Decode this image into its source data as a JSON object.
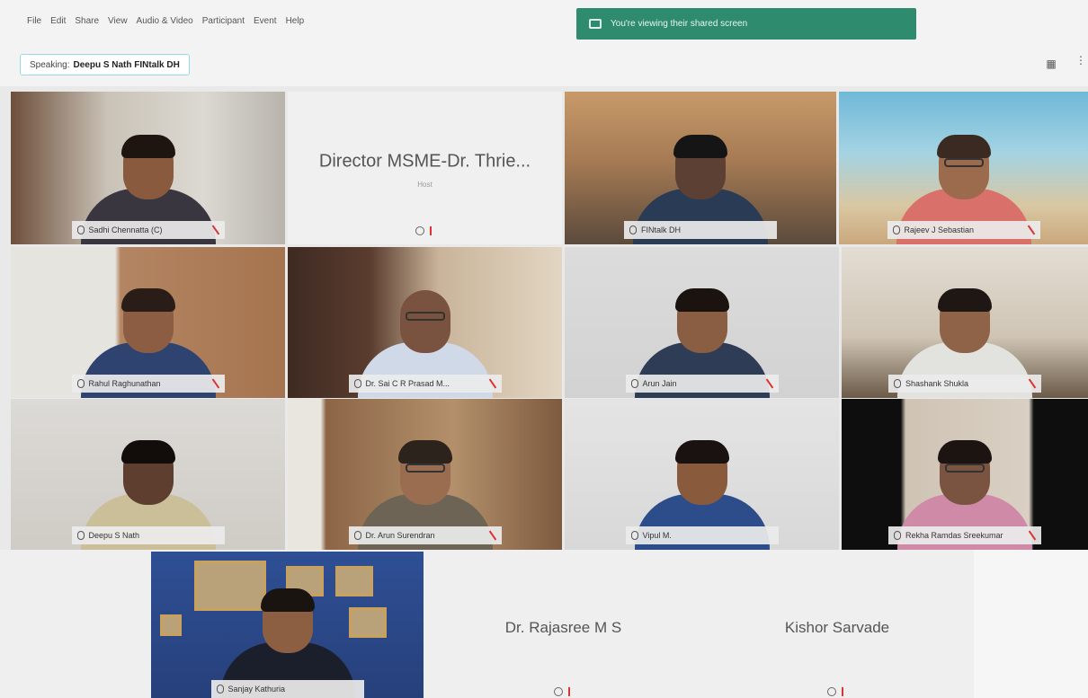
{
  "menubar": {
    "items": [
      "File",
      "Edit",
      "Share",
      "View",
      "Audio & Video",
      "Participant",
      "Event",
      "Help"
    ],
    "banner_text": "You're viewing their shared screen"
  },
  "speaking": {
    "prefix": "Speaking:",
    "name": "Deepu S Nath FINtalk DH"
  },
  "icons": {
    "view": "grid-view-icon",
    "more": "more-icon",
    "mic": "mic-icon",
    "muted": "mic-muted-icon"
  },
  "colors": {
    "active_border": "#5fc9de",
    "banner": "#2e8b6e"
  },
  "tiles": [
    {
      "name": "Sadhi Chennatta (C)"
    },
    {
      "name": "Director MSME-Dr. Thrie...",
      "sub": "Host"
    },
    {
      "name": "FINtalk DH"
    },
    {
      "name": "Rajeev J Sebastian"
    },
    {
      "name": "Rahul Raghunathan"
    },
    {
      "name": "Dr. Sai C R Prasad M..."
    },
    {
      "name": "Arun Jain"
    },
    {
      "name": "Shashank Shukla"
    },
    {
      "name": "Deepu S Nath"
    },
    {
      "name": "Dr. Arun Surendran"
    },
    {
      "name": "Vipul M."
    },
    {
      "name": "Rekha Ramdas Sreekumar"
    },
    {
      "name": "Sanjay Kathuria"
    },
    {
      "name": "Dr. Rajasree M S"
    },
    {
      "name": "Kishor Sarvade"
    }
  ]
}
